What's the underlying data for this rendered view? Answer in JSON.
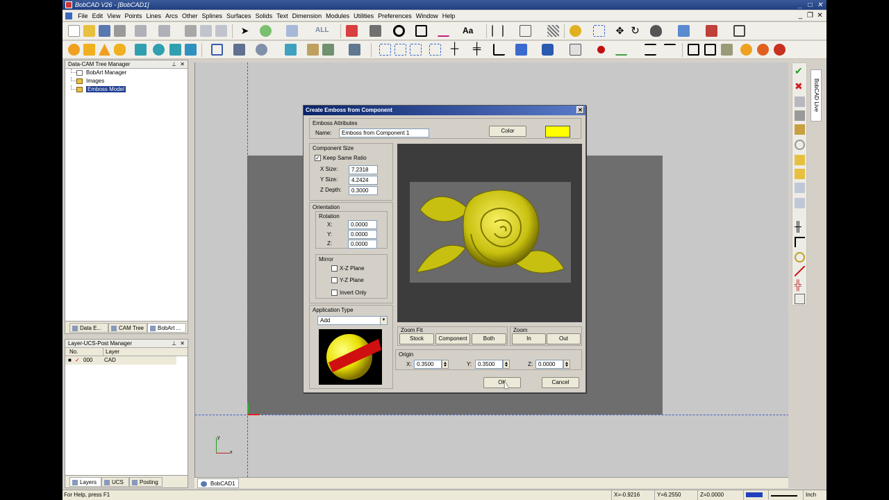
{
  "app": {
    "title": "BobCAD V26 - [BobCAD1]",
    "menus": [
      "File",
      "Edit",
      "View",
      "Points",
      "Lines",
      "Arcs",
      "Other",
      "Splines",
      "Surfaces",
      "Solids",
      "Text",
      "Dimension",
      "Modules",
      "Utilities",
      "Preferences",
      "Window",
      "Help"
    ]
  },
  "toolbar": {
    "all_label": "ALL",
    "text_label": "Aa"
  },
  "tree_panel": {
    "title": "Data-CAM Tree Manager",
    "items": [
      "BobArt Manager",
      "Images",
      "Emboss Model"
    ],
    "tabs": [
      "Data E...",
      "CAM Tree",
      "BobArt ..."
    ]
  },
  "layer_panel": {
    "title": "Layer-UCS-Post Manager",
    "headers": [
      "No.",
      "Layer"
    ],
    "rows": [
      {
        "no": "000",
        "layer": "CAD"
      }
    ],
    "tabs": [
      "Layers",
      "UCS",
      "Posting"
    ]
  },
  "side_tab": "BobCAD Live",
  "doc_tab": "BobCAD1",
  "status": {
    "help": "For Help, press F1",
    "x": "X=-0.9216",
    "y": "Y=6.2550",
    "z": "Z=0.0000",
    "unit": "Inch"
  },
  "dialog": {
    "title": "Create Emboss from Component",
    "emboss_attributes": {
      "label": "Emboss Attributes",
      "name_label": "Name:",
      "name_value": "Emboss from Component 1",
      "color_button": "Color",
      "color": "#ffff00"
    },
    "component_size": {
      "label": "Component Size",
      "keep_ratio": "Keep Same Ratio",
      "keep_ratio_checked": true,
      "x_label": "X Size:",
      "x_value": "7.2318",
      "y_label": "Y Size:",
      "y_value": "4.2424",
      "z_label": "Z Depth:",
      "z_value": "0.3000"
    },
    "orientation": {
      "label": "Orientation",
      "rotation_label": "Rotation",
      "x_label": "X:",
      "x_value": "0.0000",
      "y_label": "Y:",
      "y_value": "0.0000",
      "z_label": "Z:",
      "z_value": "0.0000",
      "mirror_label": "Mirror",
      "xz": "X-Z Plane",
      "yz": "Y-Z Plane",
      "invert": "Invert Only"
    },
    "application_type": {
      "label": "Application Type",
      "value": "Add"
    },
    "zoom_fit": {
      "label": "Zoom Fit",
      "stock": "Stock",
      "component": "Component",
      "both": "Both"
    },
    "zoom": {
      "label": "Zoom",
      "in": "In",
      "out": "Out"
    },
    "origin": {
      "label": "Origin",
      "x_label": "X:",
      "x_value": "0.3500",
      "y_label": "Y:",
      "y_value": "0.3500",
      "z_label": "Z:",
      "z_value": "0.0000"
    },
    "ok": "OK",
    "cancel": "Cancel"
  }
}
